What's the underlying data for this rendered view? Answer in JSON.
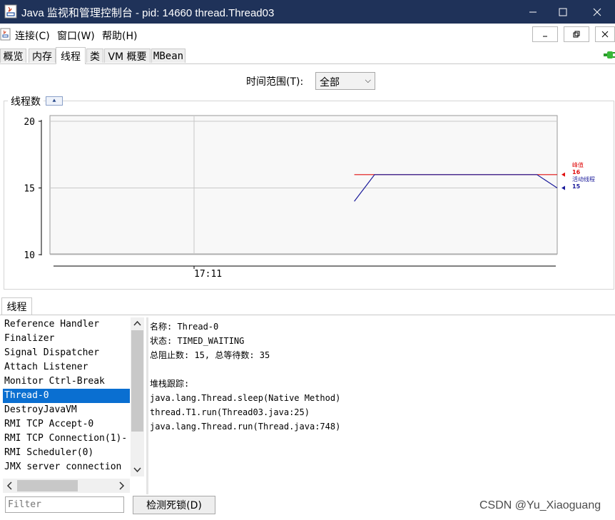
{
  "window": {
    "title": "Java 监视和管理控制台 - pid: 14660 thread.Thread03",
    "controls": [
      "minimize-icon",
      "maximize-icon",
      "close-icon"
    ]
  },
  "menu": {
    "items": [
      "连接(C)",
      "窗口(W)",
      "帮助(H)"
    ],
    "mdi_controls": [
      "minimize-icon",
      "restore-icon",
      "close-icon"
    ]
  },
  "tabs": [
    {
      "label": "概览",
      "selected": false
    },
    {
      "label": "内存",
      "selected": false
    },
    {
      "label": "线程",
      "selected": true
    },
    {
      "label": "类",
      "selected": false
    },
    {
      "label": "VM 概要",
      "selected": false
    },
    {
      "label": "MBean",
      "selected": false
    }
  ],
  "connection_icon": "plug-connected-icon",
  "time_range": {
    "label": "时间范围(T):",
    "value": "全部"
  },
  "chart_panel": {
    "title": "线程数",
    "collapse_icon": "collapse-up-icon"
  },
  "chart_data": {
    "type": "line",
    "title": "线程数",
    "ylim": [
      10,
      20
    ],
    "y_ticks": [
      "20",
      "15",
      "10"
    ],
    "x_ticks": [
      "17:11"
    ],
    "grid": true,
    "series": [
      {
        "name": "峰值",
        "color": "#e01010",
        "points": [
          [
            0.6,
            16
          ],
          [
            0.64,
            16
          ],
          [
            0.96,
            16
          ],
          [
            1.0,
            16
          ]
        ],
        "current": "16"
      },
      {
        "name": "活动线程",
        "color": "#1a1a9a",
        "points": [
          [
            0.6,
            14
          ],
          [
            0.64,
            16
          ],
          [
            0.96,
            16
          ],
          [
            1.0,
            15
          ]
        ],
        "current": "15"
      }
    ],
    "legend_position": "right"
  },
  "threads": {
    "tab_label": "线程",
    "list": [
      "Reference Handler",
      "Finalizer",
      "Signal Dispatcher",
      "Attach Listener",
      "Monitor Ctrl-Break",
      "Thread-0",
      "DestroyJavaVM",
      "RMI TCP Accept-0",
      "RMI TCP Connection(1)-",
      "RMI Scheduler(0)",
      "JMX server connection"
    ],
    "selected_index": 5,
    "details": {
      "name_line": "名称: Thread-0",
      "state_line": "状态: TIMED_WAITING",
      "counts_line": "总阻止数: 15, 总等待数: 35",
      "stack_header": "堆栈跟踪:",
      "stack": [
        "java.lang.Thread.sleep(Native Method)",
        "thread.T1.run(Thread03.java:25)",
        "java.lang.Thread.run(Thread.java:748)"
      ]
    },
    "filter_placeholder": "Filter",
    "deadlock_button": "检测死锁(D)"
  },
  "watermark": "CSDN @Yu_Xiaoguang"
}
